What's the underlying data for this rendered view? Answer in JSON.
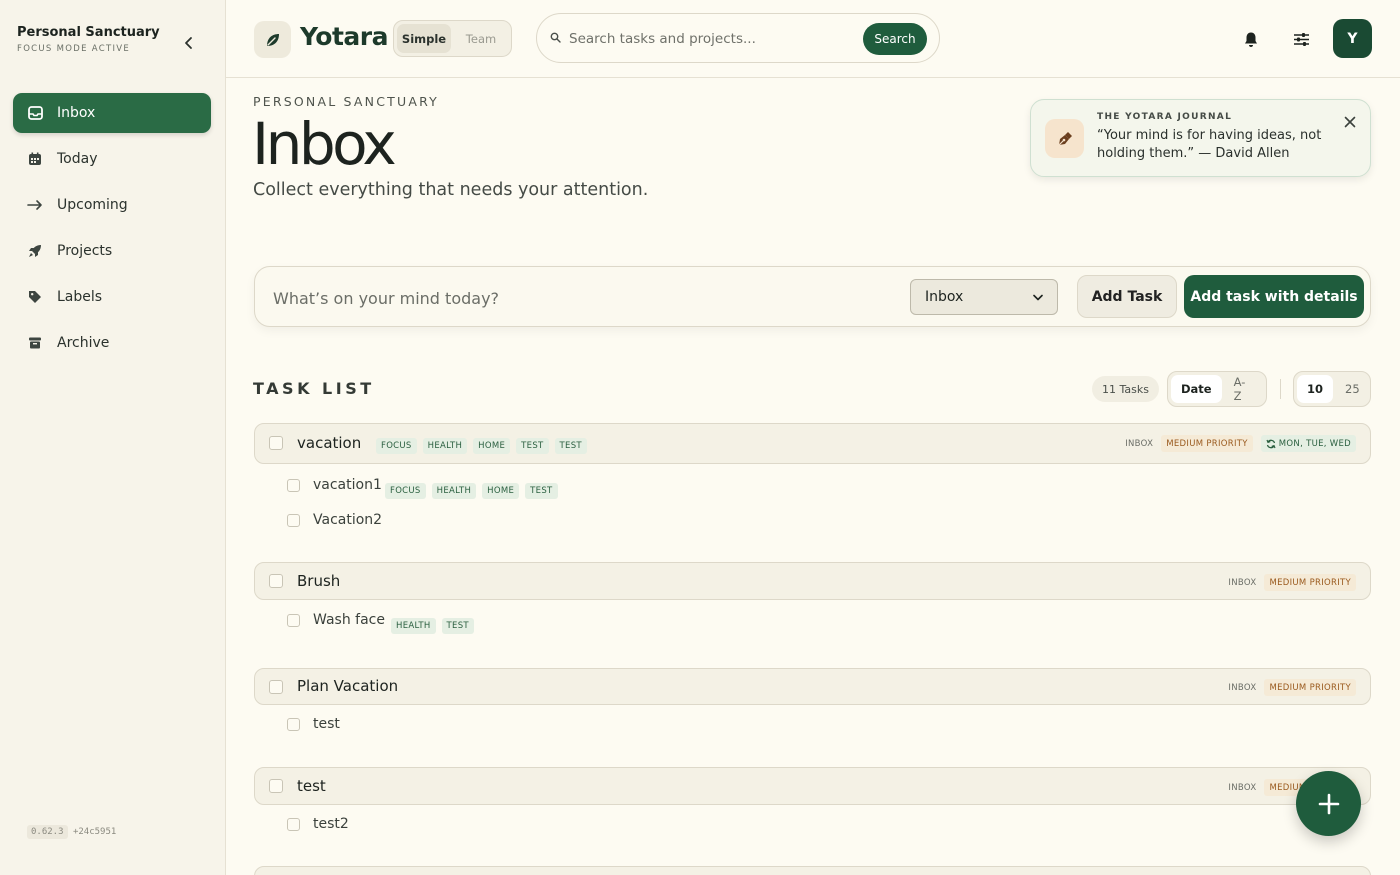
{
  "sidebar": {
    "workspace_name": "Personal Sanctuary",
    "workspace_status": "FOCUS MODE ACTIVE",
    "items": [
      {
        "label": "Inbox",
        "icon": "inbox-icon",
        "active": true
      },
      {
        "label": "Today",
        "icon": "calendar-icon",
        "active": false
      },
      {
        "label": "Upcoming",
        "icon": "arrow-right-icon",
        "active": false
      },
      {
        "label": "Projects",
        "icon": "rocket-icon",
        "active": false
      },
      {
        "label": "Labels",
        "icon": "tag-icon",
        "active": false
      },
      {
        "label": "Archive",
        "icon": "archive-icon",
        "active": false
      }
    ],
    "version": "0.62.3",
    "build": "+24c5951"
  },
  "header": {
    "app_name": "Yotara",
    "modes": [
      "Simple",
      "Team"
    ],
    "active_mode": "Simple",
    "search_placeholder": "Search tasks and projects...",
    "search_button": "Search",
    "avatar_initial": "Y"
  },
  "page": {
    "eyebrow": "PERSONAL SANCTUARY",
    "title": "Inbox",
    "subtitle": "Collect everything that needs your attention."
  },
  "journal": {
    "label": "THE YOTARA JOURNAL",
    "quote": "“Your mind is for having ideas, not holding them.” — David Allen"
  },
  "quick_add": {
    "placeholder": "What’s on your mind today?",
    "project_select": "Inbox",
    "add_button": "Add Task",
    "details_button": "Add task with details"
  },
  "task_list": {
    "heading": "TASK LIST",
    "count": "11 Tasks",
    "sort_options": [
      "Date",
      "A-Z"
    ],
    "active_sort": "Date",
    "page_sizes": [
      "10",
      "25"
    ],
    "active_page_size": "10",
    "tasks": [
      {
        "name": "vacation",
        "tags": [
          "FOCUS",
          "HEALTH",
          "HOME",
          "TEST",
          "TEST"
        ],
        "project": "INBOX",
        "priority": "MEDIUM PRIORITY",
        "repeat": "MON, TUE, WED",
        "subtasks": [
          {
            "name": "vacation1",
            "tags": [
              "FOCUS",
              "HEALTH",
              "HOME",
              "TEST"
            ]
          },
          {
            "name": "Vacation2",
            "tags": []
          }
        ]
      },
      {
        "name": "Brush",
        "tags": [],
        "project": "INBOX",
        "priority": "MEDIUM PRIORITY",
        "subtasks": [
          {
            "name": "Wash face",
            "tags": [
              "HEALTH",
              "TEST"
            ]
          }
        ]
      },
      {
        "name": "Plan Vacation",
        "tags": [],
        "project": "INBOX",
        "priority": "MEDIUM PRIORITY",
        "subtasks": [
          {
            "name": "test",
            "tags": []
          }
        ]
      },
      {
        "name": "test",
        "tags": [],
        "project": "INBOX",
        "priority": "MEDIUM PRIORITY",
        "subtasks": [
          {
            "name": "test2",
            "tags": []
          }
        ]
      }
    ]
  },
  "colors": {
    "accent": "#1f5c3d",
    "sidebar_active": "#2a6b45",
    "background": "#fdfbf2",
    "priority_text": "#9a5a1e",
    "tag_text": "#2a5f3f"
  }
}
